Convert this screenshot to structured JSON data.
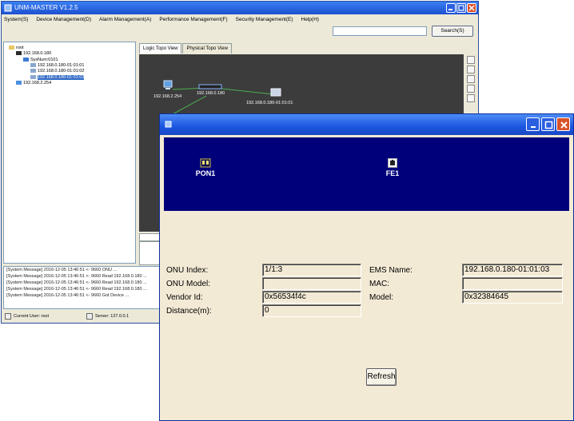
{
  "back_window": {
    "title": "UNM-MASTER V1.2.5",
    "menu": [
      "System(S)",
      "Device Management(D)",
      "Alarm Management(A)",
      "Performance Management(F)",
      "Security Management(E)",
      "Help(H)"
    ],
    "search_button": "Search(S)",
    "search_value": "",
    "tree": [
      {
        "label": "root",
        "level": 0,
        "icon": "folder-icon",
        "selected": false
      },
      {
        "label": "192.168.0.180",
        "level": 1,
        "icon": "olt-icon",
        "selected": false
      },
      {
        "label": "SysNum:0101",
        "level": 2,
        "icon": "card-icon",
        "selected": false
      },
      {
        "label": "192.168.0.180-01:01:01",
        "level": 3,
        "icon": "onu-icon",
        "selected": false
      },
      {
        "label": "192.168.0.180-01:01:02",
        "level": 3,
        "icon": "onu-icon",
        "selected": false
      },
      {
        "label": "192.168.0.180-01:01:03",
        "level": 3,
        "icon": "onu-icon",
        "selected": true
      },
      {
        "label": "192.168.2.254",
        "level": 1,
        "icon": "host-icon",
        "selected": false
      }
    ],
    "tabs": [
      "Logic Topo View",
      "Physical Topo View"
    ],
    "topo_labels": {
      "node_a": "192.168.2.254",
      "node_b": "192.168.0.180",
      "node_c": "192.168.0.180-01:01:01"
    },
    "log_lines": [
      "[System Message]  2016-12-05 13:46:51 <- 9660 ONU ...",
      "[System Message]  2016-12-05 13:46:51 <- 9660 Read 192.168.0.180 ...",
      "[System Message]  2016-12-05 13:46:51 <- 9660 Read 192.168.0.180 ...",
      "[System Message]  2016-12-05 13:46:51 <- 9660 Read 192.168.0.180 ...",
      "[System Message]  2016-12-05 13:46:51 <- 9660 Got Device ..."
    ],
    "status": {
      "left": "Current User: root",
      "right": "Server: 127.0.0.1"
    }
  },
  "dialog": {
    "ports": [
      {
        "label": "PON1",
        "icon": "pon-port-icon"
      },
      {
        "label": "FE1",
        "icon": "ethernet-port-icon"
      }
    ],
    "fields": {
      "onu_index": {
        "label": "ONU Index:",
        "value": "1/1:3"
      },
      "onu_model": {
        "label": "ONU Model:",
        "value": ""
      },
      "vendor_id": {
        "label": "Vendor Id:",
        "value": "0x56534f4c"
      },
      "distance": {
        "label": "Distance(m):",
        "value": "0"
      },
      "ems_name": {
        "label": "EMS Name:",
        "value": "192.168.0.180-01:01:03"
      },
      "mac": {
        "label": "MAC:",
        "value": ""
      },
      "model": {
        "label": "Model:",
        "value": "0x32384645"
      }
    },
    "refresh_label": "Refresh"
  },
  "colors": {
    "titlebar": "#1c56e0",
    "port_panel": "#00007a",
    "dialog_bg": "#f3ead5",
    "topo_canvas": "#3c3c3c",
    "close_button": "#d9532a"
  }
}
